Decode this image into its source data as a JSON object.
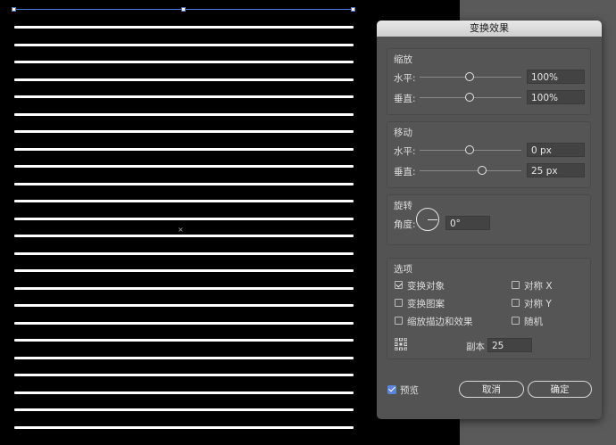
{
  "dialog": {
    "title": "变换效果",
    "scale": {
      "title": "缩放",
      "horizontal_label": "水平:",
      "horizontal_value": "100%",
      "vertical_label": "垂直:",
      "vertical_value": "100%"
    },
    "move": {
      "title": "移动",
      "horizontal_label": "水平:",
      "horizontal_value": "0 px",
      "vertical_label": "垂直:",
      "vertical_value": "25 px"
    },
    "rotate": {
      "title": "旋转",
      "angle_label": "角度:",
      "angle_value": "0°"
    },
    "options": {
      "title": "选项",
      "transform_objects": "变换对象",
      "transform_patterns": "变换图案",
      "scale_strokes": "缩放描边和效果",
      "reflect_x": "对称 X",
      "reflect_y": "对称 Y",
      "random": "随机",
      "copies_label": "副本",
      "copies_value": "25"
    },
    "preview_label": "预览",
    "cancel_label": "取消",
    "ok_label": "确定"
  },
  "colors": {
    "dialog_bg": "#535353",
    "selection": "#4a7bd8",
    "preview_check": "#5b86d6"
  },
  "icons": [
    "reference-point-icon",
    "angle-dial-icon",
    "checkbox-icon"
  ]
}
